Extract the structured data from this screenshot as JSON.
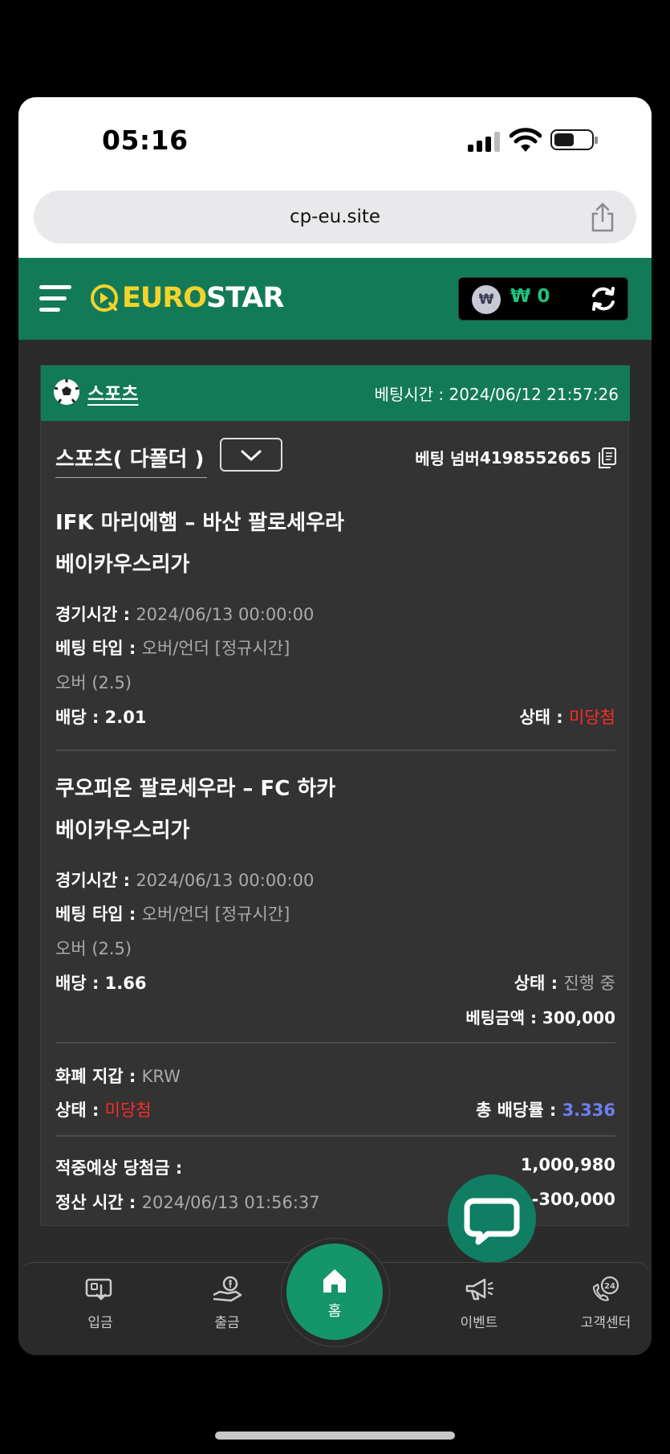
{
  "status_bar": {
    "time": "05:16"
  },
  "browser": {
    "url": "cp-eu.site"
  },
  "header": {
    "logo_prefix": "EURO",
    "logo_suffix": "STAR",
    "currency_symbol": "₩",
    "balance": "₩ 0"
  },
  "card": {
    "title": "스포츠",
    "bet_time_label": "베팅시간 : ",
    "bet_time": "2024/06/12 21:57:26",
    "bet_type_title": "스포츠( 다폴더 )",
    "bet_number_label": "베팅 넘버",
    "bet_number": "4198552665",
    "matches": [
      {
        "teams_line1": "IFK 마리에햄 – 바산 팔로세우라",
        "teams_line2": "베이카우스리가",
        "game_time_label": "경기시간 : ",
        "game_time": "2024/06/13 00:00:00",
        "bet_kind_label": "베팅 타입 : ",
        "bet_kind": "오버/언더 [정규시간]",
        "pick": "오버 (2.5)",
        "odds_label": "배당 : ",
        "odds": "2.01",
        "status_label": "상태 : ",
        "status": "미당첨"
      },
      {
        "teams_line1": "쿠오피온 팔로세우라 – FC 하카",
        "teams_line2": "베이카우스리가",
        "game_time_label": "경기시간 : ",
        "game_time": "2024/06/13 00:00:00",
        "bet_kind_label": "베팅 타입 : ",
        "bet_kind": "오버/언더 [정규시간]",
        "pick": "오버 (2.5)",
        "odds_label": "배당 : ",
        "odds": "1.66",
        "status_label": "상태 : ",
        "status": "진행 중"
      }
    ],
    "bet_amount_label": "베팅금액 : ",
    "bet_amount": "300,000",
    "currency_label": "화폐 지갑 : ",
    "currency": "KRW",
    "overall_status_label": "상태 : ",
    "overall_status": "미당첨",
    "total_odds_label": "총 배당률 : ",
    "total_odds": "3.336",
    "expected_win_label": "적중예상 당첨금 : ",
    "expected_win": "1,000,980",
    "settle_time_label": "정산 시간 : ",
    "settle_time": "2024/06/13 01:56:37",
    "settle_amount": "-300,000"
  },
  "nav": {
    "deposit": "입금",
    "withdraw": "출금",
    "home": "홈",
    "event": "이벤트",
    "support": "고객센터",
    "support_badge": "24"
  },
  "colors": {
    "brand_green": "#137a57",
    "logo_yellow": "#f5d32a",
    "lost_red": "#ff2a2a",
    "odds_blue": "#6d7ff0",
    "balance_green": "#1ec27e"
  }
}
